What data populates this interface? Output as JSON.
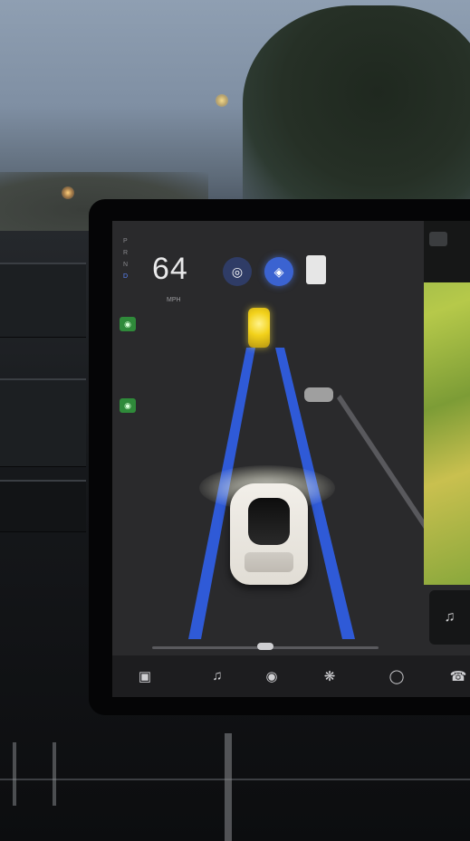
{
  "display": {
    "gear_selector": [
      "P",
      "R",
      "N",
      "D"
    ],
    "active_gear": "D",
    "speed": "64",
    "speed_unit": "MPH",
    "top_center_text": "",
    "status_right": "",
    "lane_side_label": "",
    "autopilot_icons": [
      "steering-wheel-icon",
      "autopilot-icon"
    ],
    "speed_limit_sign": "",
    "map_top_label": "",
    "accent_color": "#3b63d1",
    "lead_vehicle_color": "#f2d11a",
    "lane_line_color": "#2f5de0"
  },
  "taskbar": {
    "icons": [
      "car-icon",
      "music-icon",
      "camera-icon",
      "fan-icon",
      "app-icon",
      "phone-icon"
    ]
  }
}
